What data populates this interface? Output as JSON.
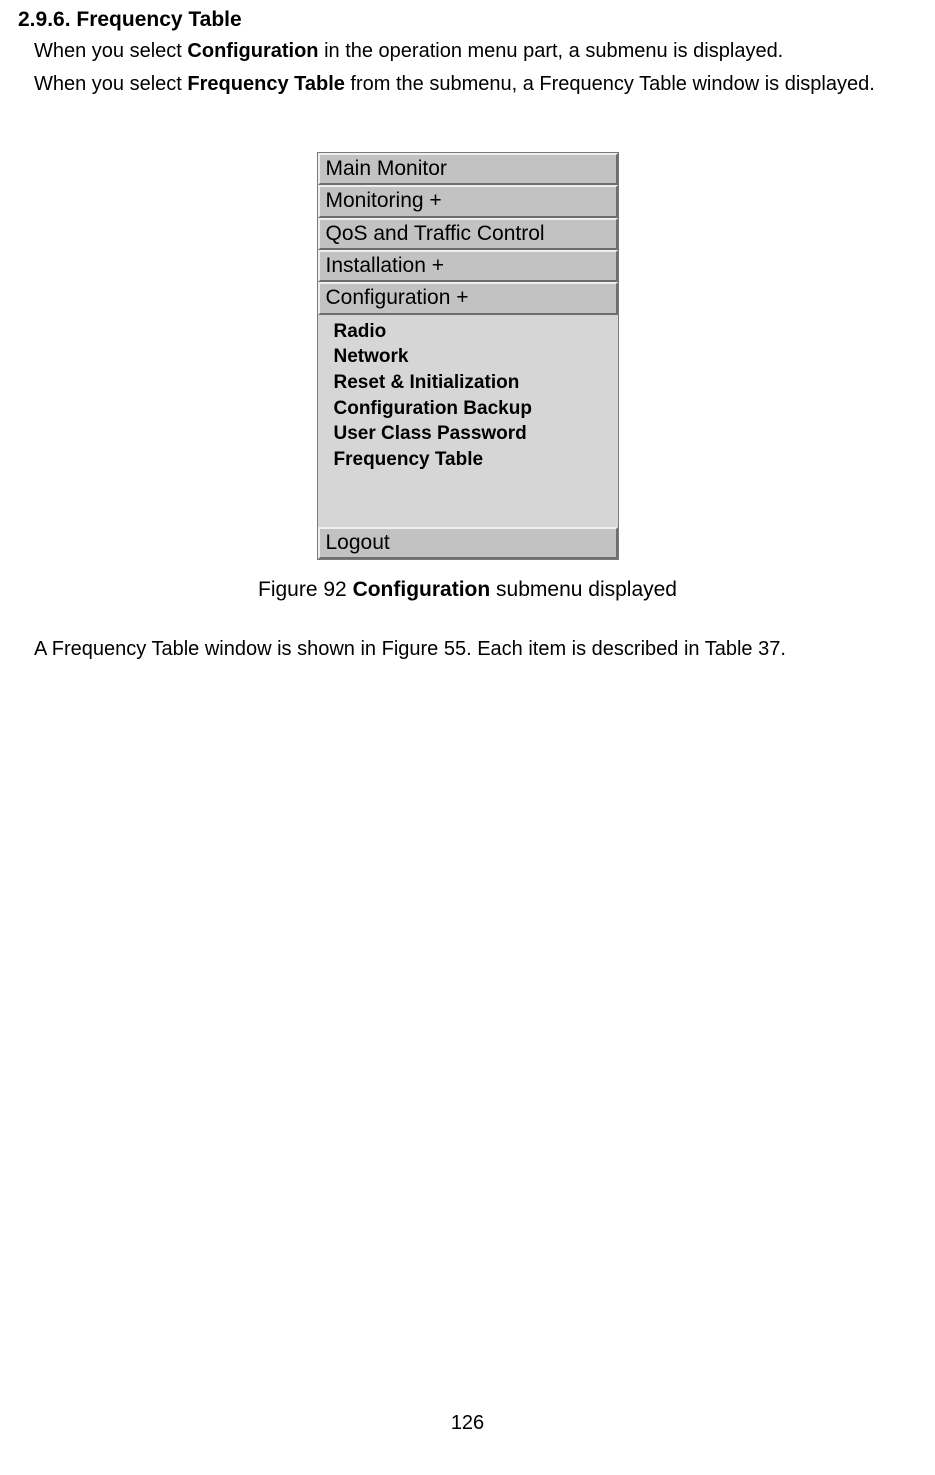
{
  "heading": "2.9.6. Frequency Table",
  "para1_a": "When you select ",
  "para1_bold": "Configuration",
  "para1_b": " in the operation menu part, a submenu is displayed.",
  "para2_a": "When you select ",
  "para2_bold": "Frequency Table",
  "para2_b": " from the submenu, a Frequency Table window is displayed.",
  "menu": {
    "main_monitor": "Main Monitor",
    "monitoring": "Monitoring +",
    "qos": "QoS and Traffic Control",
    "installation": "Installation +",
    "configuration": "Configuration +",
    "submenu": {
      "radio": "Radio",
      "network": "Network",
      "reset": "Reset & Initialization",
      "backup": "Configuration Backup",
      "password": "User Class Password",
      "freq": "Frequency Table"
    },
    "logout": "Logout"
  },
  "caption_a": "Figure 92 ",
  "caption_bold": "Configuration",
  "caption_b": " submenu displayed",
  "para3": "A Frequency Table window is shown in Figure 55. Each item is described in Table 37.",
  "page_number": "126"
}
